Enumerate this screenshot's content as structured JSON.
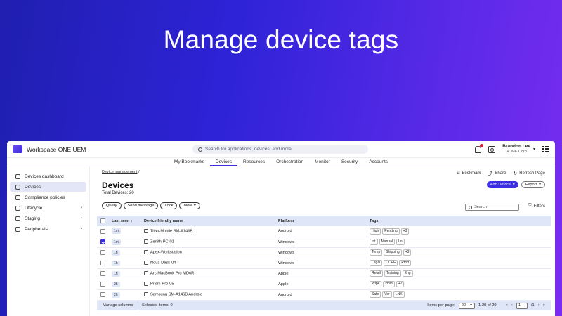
{
  "headline": "Manage device tags",
  "app": {
    "brand": "Workspace ONE UEM",
    "search_placeholder": "Search for applications, devices, and more",
    "user_name": "Brandon Lee",
    "user_org": "ACME Corp"
  },
  "nav": [
    "My Bookmarks",
    "Devices",
    "Resources",
    "Orchestration",
    "Monitor",
    "Security",
    "Accounts"
  ],
  "sidebar": [
    {
      "label": "Devices dashboard"
    },
    {
      "label": "Devices"
    },
    {
      "label": "Compliance policies"
    },
    {
      "label": "Lifecycle"
    },
    {
      "label": "Staging"
    },
    {
      "label": "Peripherals"
    }
  ],
  "page": {
    "breadcrumb": "Device management",
    "crumb_sep": "/",
    "title": "Devices",
    "total": "Total Devices: 20",
    "bookmark": "Bookmark",
    "share": "Share",
    "refresh": "Refresh Page",
    "add_device": "Add Device",
    "export": "Export"
  },
  "toolbar": {
    "query": "Query",
    "send_message": "Send message",
    "lock": "Lock",
    "more": "More",
    "search": "Search",
    "filters": "Filters"
  },
  "table": {
    "headers": [
      "Last seen",
      "Device friendly name",
      "Platform",
      "Tags"
    ],
    "rows": [
      {
        "last_seen": "1m",
        "name": "Titan-Mobile SM-A146B",
        "platform": "Android",
        "tags": [
          "High",
          "Pending",
          "+3"
        ],
        "checked": false
      },
      {
        "last_seen": "1m",
        "name": "Zenith-PC-01",
        "platform": "Windows",
        "tags": [
          "Int",
          "Manual",
          "Lo"
        ],
        "checked": true
      },
      {
        "last_seen": "1h",
        "name": "Apex-Workstation",
        "platform": "Windows",
        "tags": [
          "Temp",
          "Shipping",
          "+3"
        ],
        "checked": false
      },
      {
        "last_seen": "1h",
        "name": "Nova-Desk-04",
        "platform": "Windows",
        "tags": [
          "Legal",
          "COPE",
          "Prod"
        ],
        "checked": false
      },
      {
        "last_seen": "1h",
        "name": "Arc-MacBook Pro MD6R",
        "platform": "Apple",
        "tags": [
          "Retail",
          "Training",
          "Eng"
        ],
        "checked": false
      },
      {
        "last_seen": "2h",
        "name": "Prism-Pro-05",
        "platform": "Apple",
        "tags": [
          "Wipe",
          "Hold",
          "+2"
        ],
        "checked": false
      },
      {
        "last_seen": "2h",
        "name": "Samsung SM-A146B Android",
        "platform": "Android",
        "tags": [
          "Safe",
          "Ver",
          "LNX"
        ],
        "checked": false
      }
    ]
  },
  "footer": {
    "manage_columns": "Manage columns",
    "selected": "Selected items: 0",
    "items_per_page_label": "Items per page:",
    "items_per_page": "20",
    "range": "1-20 of 20",
    "page": "1",
    "page_total": "/1"
  },
  "colors": {
    "accent": "#3a2ee0",
    "header_bg": "#dfe6f7"
  }
}
